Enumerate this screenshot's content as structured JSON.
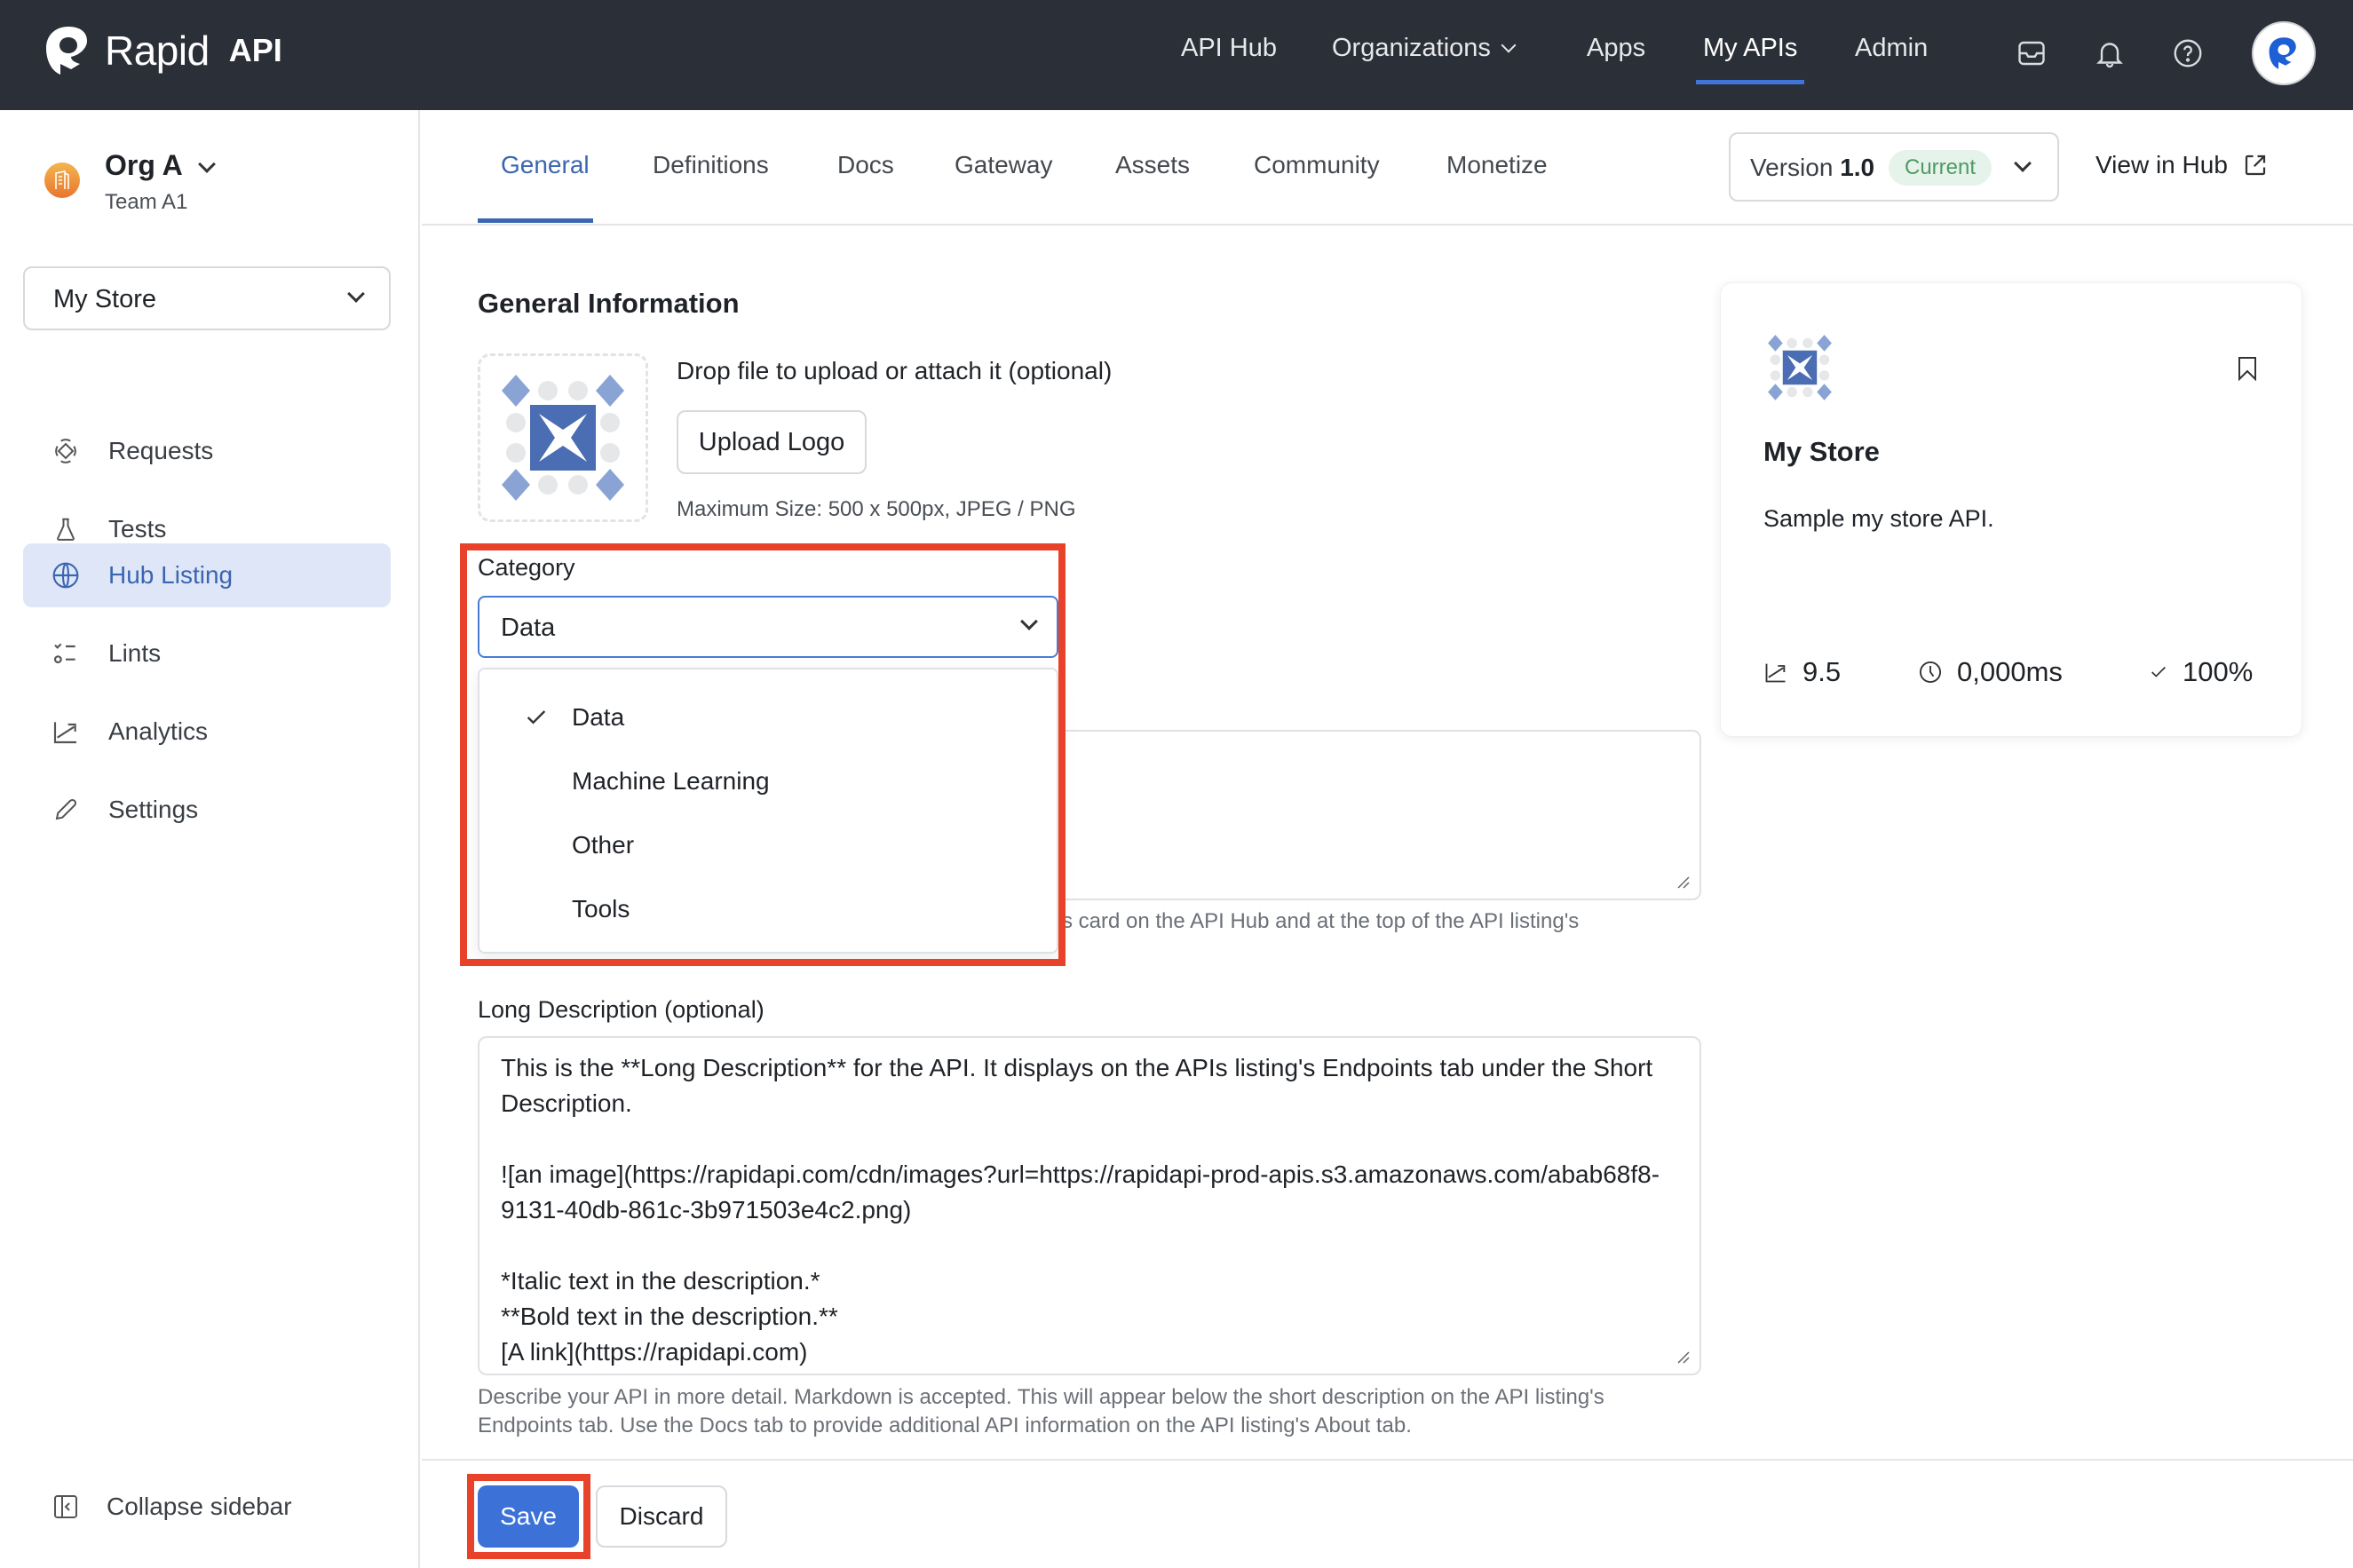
{
  "app": {
    "brand": "Rapid",
    "brand_suffix": "API"
  },
  "topnav": {
    "items": [
      {
        "label": "API Hub"
      },
      {
        "label": "Organizations",
        "has_dropdown": true
      },
      {
        "label": "Apps"
      },
      {
        "label": "My APIs",
        "active": true
      },
      {
        "label": "Admin"
      }
    ],
    "icons": [
      "inbox-icon",
      "bell-icon",
      "help-icon"
    ],
    "accent": "#3f74d8"
  },
  "sidebar": {
    "org_name": "Org A",
    "team_name": "Team A1",
    "api_select": "My Store",
    "items": [
      {
        "label": "Requests",
        "icon": "requests-icon"
      },
      {
        "label": "Tests",
        "icon": "flask-icon"
      },
      {
        "label": "Hub Listing",
        "icon": "globe-icon",
        "active": true
      },
      {
        "label": "Lints",
        "icon": "checklist-icon"
      },
      {
        "label": "Analytics",
        "icon": "chart-line-icon"
      },
      {
        "label": "Settings",
        "icon": "pencil-icon"
      }
    ],
    "collapse_label": "Collapse sidebar"
  },
  "tabs": {
    "items": [
      {
        "label": "General",
        "active": true
      },
      {
        "label": "Definitions"
      },
      {
        "label": "Docs"
      },
      {
        "label": "Gateway"
      },
      {
        "label": "Assets"
      },
      {
        "label": "Community"
      },
      {
        "label": "Monetize"
      }
    ],
    "version_prefix": "Version",
    "version_number": "1.0",
    "version_badge": "Current",
    "view_in_hub": "View in Hub"
  },
  "general": {
    "title": "General Information",
    "drop_text": "Drop file to upload or attach it (optional)",
    "upload_button": "Upload Logo",
    "max_size": "Maximum Size: 500 x 500px, JPEG / PNG",
    "category_label": "Category",
    "category_value": "Data",
    "category_options": [
      {
        "label": "Data",
        "selected": true
      },
      {
        "label": "Machine Learning"
      },
      {
        "label": "Other"
      },
      {
        "label": "Tools"
      }
    ],
    "short_desc_help": "s card on the API Hub and at the top of the API listing's",
    "long_desc_label": "Long Description (optional)",
    "long_desc_value": "This is the **Long Description** for the API. It displays on the APIs listing's Endpoints tab under the Short Description.\n\n![an image](https://rapidapi.com/cdn/images?url=https://rapidapi-prod-apis.s3.amazonaws.com/abab68f8-9131-40db-861c-3b971503e4c2.png)\n\n*Italic text in the description.*\n**Bold text in the description.**\n[A link](https://rapidapi.com)",
    "long_desc_help": "Describe your API in more detail. Markdown is accepted. This will appear below the short description on the API listing's Endpoints tab. Use the Docs tab to provide additional API information on the API listing's About tab."
  },
  "footer": {
    "save": "Save",
    "discard": "Discard"
  },
  "preview_card": {
    "title": "My Store",
    "description": "Sample my store API.",
    "popularity": "9.5",
    "latency": "0,000ms",
    "success_rate": "100%"
  },
  "highlights": {
    "color": "#e8432a"
  }
}
